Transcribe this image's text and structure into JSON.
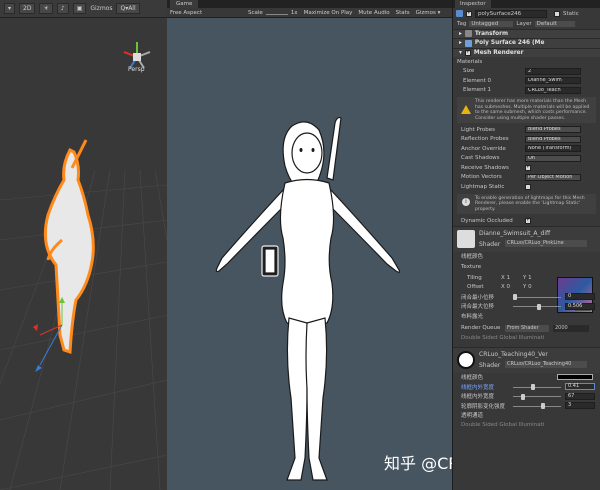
{
  "scene": {
    "toolbar": {
      "mode_2d": "2D",
      "gizmos": "Gizmos",
      "search": "Q▾All"
    },
    "persp_label": "Persp"
  },
  "game": {
    "tab": "Game",
    "aspect": "Free Aspect",
    "scale_label": "Scale",
    "scale_value": "1x",
    "maximize": "Maximize On Play",
    "mute": "Mute Audio",
    "stats": "Stats",
    "gizmos": "Gizmos ▾"
  },
  "watermark": "知乎 @CRomputer罗老师",
  "inspector": {
    "tab": "Inspector",
    "object_name": "polySurface246",
    "static": "Static",
    "tag_label": "Tag",
    "tag": "Untagged",
    "layer_label": "Layer",
    "layer": "Default",
    "components": {
      "transform": "Transform",
      "poly": "Poly Surface 246 (Me",
      "mesh_renderer": "Mesh Renderer"
    },
    "materials": {
      "heading": "Materials",
      "size_label": "Size",
      "size": "2",
      "element0_label": "Element 0",
      "element0": "Dianne_Swim",
      "element1_label": "Element 1",
      "element1": "CRLuo_Teach"
    },
    "warning": "This renderer has more materials than the Mesh has submeshes. Multiple materials will be applied to the same submesh, which costs performance. Consider using multiple shader passes.",
    "props": [
      {
        "label": "Light Probes",
        "value": "Blend Probes"
      },
      {
        "label": "Reflection Probes",
        "value": "Blend Probes"
      },
      {
        "label": "Anchor Override",
        "value": "None (Transform)"
      },
      {
        "label": "Cast Shadows",
        "value": "On"
      },
      {
        "label": "Receive Shadows",
        "value": ""
      },
      {
        "label": "Motion Vectors",
        "value": "Per Object Motion"
      }
    ],
    "lightmap_static": "Lightmap Static",
    "lightmap_info": "To enable generation of lightmaps for this Mesh Renderer, please enable the 'Lightmap Static' property.",
    "dynamic_occluded": "Dynamic Occluded",
    "mat1": {
      "name": "Dianne_Swimsuit_A_diff",
      "shader_label": "Shader",
      "shader": "CRLuo/CRLuo_PinkLine",
      "line_color": "线框颜色",
      "texture": "Texture",
      "tiling": "Tiling",
      "offset": "Offset",
      "tx": "X 1",
      "ty": "Y 1",
      "ox": "X 0",
      "oy": "Y 0",
      "select": "Select",
      "s1": "闭合最小位移",
      "s1v": "0",
      "s2": "闭合最大位移",
      "s2v": "0.506",
      "s3": "布料露光",
      "render_queue": "Render Queue",
      "rq_from": "From Shader",
      "rq_value": "2000",
      "dsgi": "Double Sided Global Illuminati"
    },
    "mat2": {
      "name": "CRLuo_Teaching40_Ver",
      "shader_label": "Shader",
      "shader": "CRLuo/CRLuo_Teaching40",
      "line_color": "线框颜色",
      "w_in": "线框内外宽度",
      "w_in_v": "0.41",
      "w_out": "线框内外宽度",
      "w_out_v": "67",
      "edge": "轮廓阴影变化强度",
      "edge_v": "3",
      "alpha": "透明通道",
      "dsgi": "Double Sided Global Illuminati"
    }
  }
}
